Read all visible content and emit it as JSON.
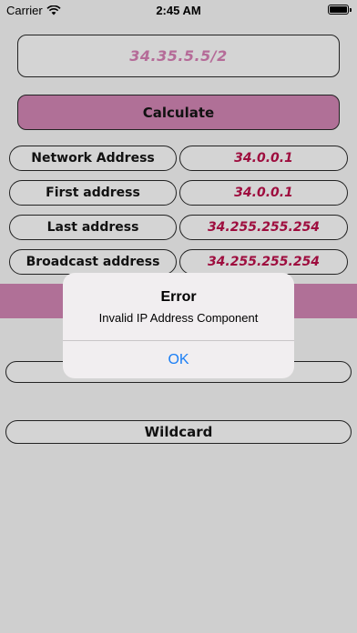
{
  "status_bar": {
    "carrier": "Carrier",
    "time": "2:45 AM"
  },
  "input": {
    "value": "34.35.5.5/2"
  },
  "calculate_button": {
    "label": "Calculate"
  },
  "results": [
    {
      "label": "Network Address",
      "value": "34.0.0.1"
    },
    {
      "label": "First address",
      "value": "34.0.0.1"
    },
    {
      "label": "Last address",
      "value": "34.255.255.254"
    },
    {
      "label": "Broadcast address",
      "value": "34.255.255.254"
    }
  ],
  "wildcard": {
    "label": "Wildcard"
  },
  "alert": {
    "title": "Error",
    "message": "Invalid IP Address Component",
    "ok_label": "OK"
  },
  "colors": {
    "accent": "#b07097",
    "value_text": "#9e0d3e",
    "link": "#1a7ef5"
  }
}
